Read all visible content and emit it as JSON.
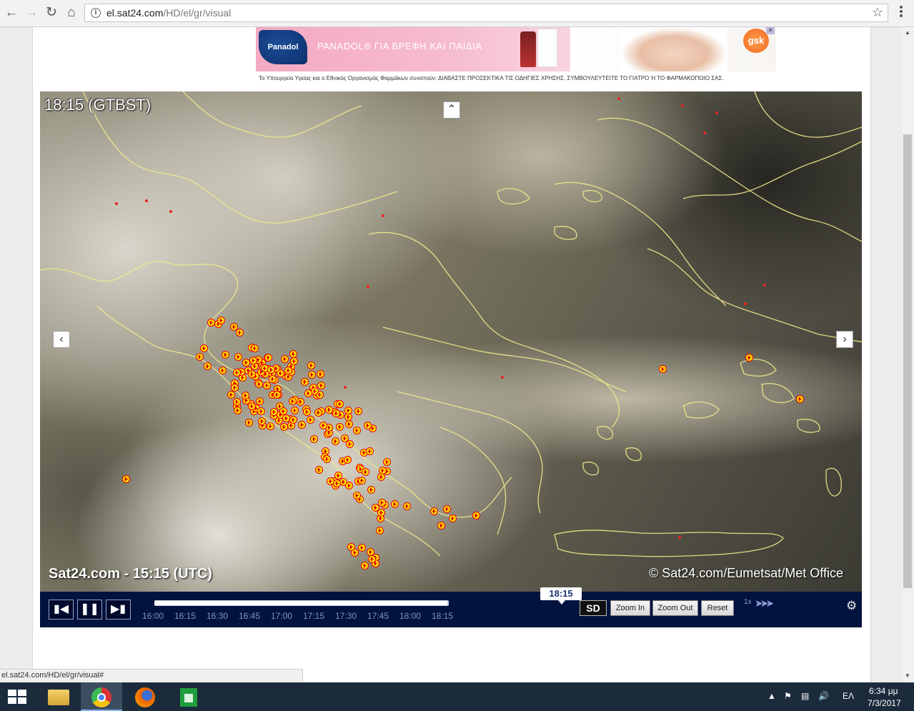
{
  "browser": {
    "url_host": "el.sat24.com",
    "url_path": "/HD/el/gr/visual",
    "status_url": "el.sat24.com/HD/el/gr/visual#"
  },
  "ad": {
    "logo_text": "Panadol",
    "headline": "PANADOL® ΓΙΑ ΒΡΕΦΗ ΚΑΙ ΠΑΙΔΙΑ",
    "brand_badge": "gsk",
    "disclaimer_prefix": "Το Υπουργείο Υγείας και ο Εθνικός Οργανισμός Φαρμάκων συνιστούν:",
    "disclaimer_main": "ΔΙΑΒΑΣΤΕ ΠΡΟΣΕΚΤΙΚΑ ΤΙΣ ΟΔΗΓΙΕΣ ΧΡΗΣΗΣ. ΣΥΜΒΟΥΛΕΥΤΕΙΤΕ ΤΟ ΓΙΑΤΡΟ Ή ΤΟ ΦΑΡΜΑΚΟΠΟΙΟ ΣΑΣ."
  },
  "map": {
    "timestamp_local": "18:15 (GTBST)",
    "watermark_left": "Sat24.com - 15:15 (UTC)",
    "watermark_right": "© Sat24.com/Eumetsat/Met Office"
  },
  "controls": {
    "current_time": "18:15",
    "time_labels": [
      "16:00",
      "16:15",
      "16:30",
      "16:45",
      "17:00",
      "17:15",
      "17:30",
      "17:45",
      "18:00",
      "18:15"
    ],
    "progress": 1.0,
    "sd_label": "SD",
    "zoom_in_label": "Zoom In",
    "zoom_out_label": "Zoom Out",
    "reset_label": "Reset",
    "speed_label": "1x"
  },
  "taskbar": {
    "language": "ΕΛ",
    "clock_time": "6:34 μμ",
    "clock_date": "7/3/2017"
  }
}
